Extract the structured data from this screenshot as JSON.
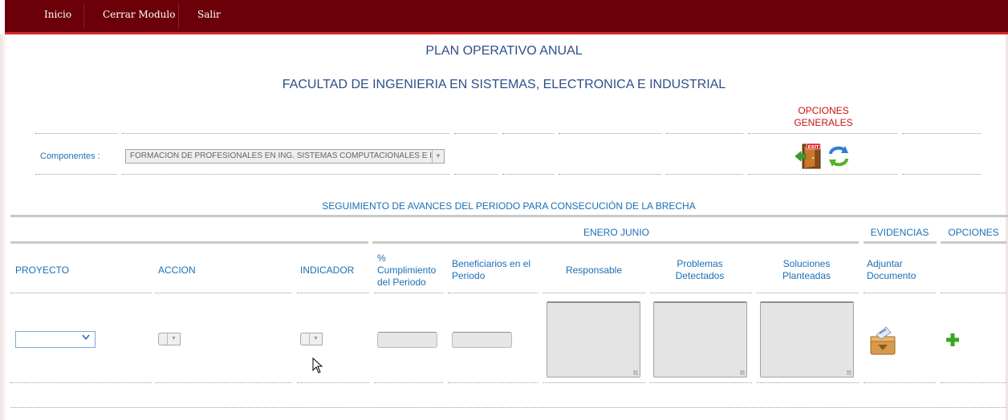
{
  "nav": {
    "items": [
      "Inicio",
      "Cerrar Modulo",
      "Salir"
    ]
  },
  "page": {
    "title": "PLAN OPERATIVO ANUAL",
    "faculty": "FACULTAD DE INGENIERIA EN SISTEMAS, ELECTRONICA E INDUSTRIAL"
  },
  "general": {
    "options_label_1": "OPCIONES",
    "options_label_2": "GENERALES",
    "componentes_label": "Componentes :",
    "componentes_value": "FORMACION DE PROFESIONALES EN ING. SISTEMAS COMPUTACIONALES E I",
    "exit_icon": "exit-door-icon",
    "refresh_icon": "refresh-arrows-icon"
  },
  "section_title": "SEGUIMIENTO DE AVANCES DEL PERIODO PARA CONSECUCIÓN DE LA BRECHA",
  "table": {
    "group_headers": {
      "period": "ENERO JUNIO",
      "evidencias": "EVIDENCIAS",
      "opciones": "OPCIONES"
    },
    "columns": {
      "proyecto": "PROYECTO",
      "accion": "ACCION",
      "indicador": "INDICADOR",
      "cumplimiento_1": "%",
      "cumplimiento_2": "Cumplimiento",
      "cumplimiento_3": "del Periodo",
      "beneficiarios_1": "Beneficiarios en el",
      "beneficiarios_2": "Periodo",
      "responsable": "Responsable",
      "problemas_1": "Problemas",
      "problemas_2": "Detectados",
      "soluciones_1": "Soluciones",
      "soluciones_2": "Planteadas",
      "adjuntar_1": "Adjuntar",
      "adjuntar_2": "Documento"
    },
    "row": {
      "proyecto_value": "",
      "accion_value": "",
      "indicador_value": "",
      "cumplimiento_value": "",
      "beneficiarios_value": "",
      "responsable_value": "",
      "problemas_value": "",
      "soluciones_value": "",
      "attach_icon": "upload-box-icon",
      "add_icon": "plus-icon"
    }
  },
  "colors": {
    "nav_bg": "#6b0009",
    "nav_border": "#d32a2a",
    "title": "#2f4f8a",
    "label_blue": "#1a6fb5",
    "options_red": "#cc1111"
  }
}
